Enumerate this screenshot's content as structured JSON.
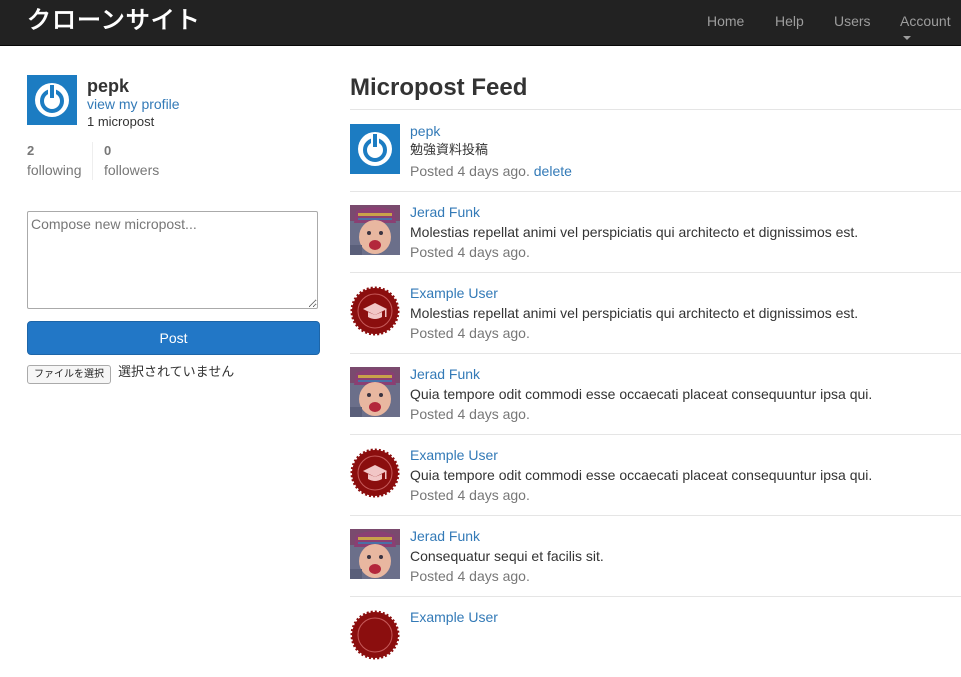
{
  "header": {
    "brand": "クローンサイト",
    "nav": [
      "Home",
      "Help",
      "Users",
      "Account"
    ]
  },
  "sidebar": {
    "user_name": "pepk",
    "profile_link": "view my profile",
    "micropost_count": "1 micropost",
    "following_count": "2",
    "following_label": "following",
    "followers_count": "0",
    "followers_label": "followers",
    "compose_placeholder": "Compose new micropost...",
    "post_button": "Post",
    "file_button": "ファイルを選択",
    "file_status": "選択されていません"
  },
  "feed": {
    "title": "Micropost Feed",
    "items": [
      {
        "user": "pepk",
        "avatar": "power-avatar",
        "content": "勉強資料投稿",
        "time": "Posted 4 days ago.",
        "delete": "delete"
      },
      {
        "user": "Jerad Funk",
        "avatar": "baby-photo-avatar",
        "content": "Molestias repellat animi vel perspiciatis qui architecto et dignissimos est.",
        "time": "Posted 4 days ago."
      },
      {
        "user": "Example User",
        "avatar": "grad-cap-seal-avatar",
        "content": "Molestias repellat animi vel perspiciatis qui architecto et dignissimos est.",
        "time": "Posted 4 days ago."
      },
      {
        "user": "Jerad Funk",
        "avatar": "baby-photo-avatar",
        "content": "Quia tempore odit commodi esse occaecati placeat consequuntur ipsa qui.",
        "time": "Posted 4 days ago."
      },
      {
        "user": "Example User",
        "avatar": "grad-cap-seal-avatar",
        "content": "Quia tempore odit commodi esse occaecati placeat consequuntur ipsa qui.",
        "time": "Posted 4 days ago."
      },
      {
        "user": "Jerad Funk",
        "avatar": "baby-photo-avatar",
        "content": "Consequatur sequi et facilis sit.",
        "time": "Posted 4 days ago."
      },
      {
        "user": "Example User",
        "avatar": "grad-cap-seal-avatar"
      }
    ]
  },
  "colors": {
    "navbar": "#222222",
    "link": "#337ab7",
    "post_button": "#2277c6",
    "seal_red": "#8b0e0e",
    "power_blue": "#1c7cc2"
  }
}
